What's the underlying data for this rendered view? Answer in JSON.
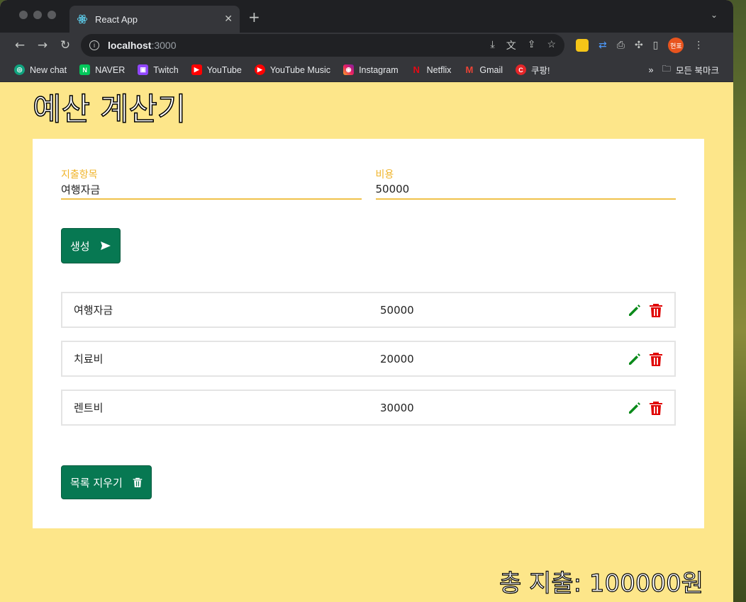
{
  "browser": {
    "tab_title": "React App",
    "url_host": "localhost",
    "url_port": ":3000",
    "avatar_text": "현표",
    "bookmarks": [
      "New chat",
      "NAVER",
      "Twitch",
      "YouTube",
      "YouTube Music",
      "Instagram",
      "Netflix",
      "Gmail",
      "쿠팡!"
    ],
    "bookmarks_overflow": "»",
    "all_bookmarks": "모든 북마크"
  },
  "app": {
    "title": "예산 계산기",
    "form": {
      "item_label": "지출항목",
      "item_value": "여행자금",
      "cost_label": "비용",
      "cost_value": "50000",
      "submit_label": "생성"
    },
    "expenses": [
      {
        "name": "여행자금",
        "cost": "50000"
      },
      {
        "name": "치료비",
        "cost": "20000"
      },
      {
        "name": "렌트비",
        "cost": "30000"
      }
    ],
    "clear_label": "목록 지우기",
    "total_text": "총 지출: 100000원"
  },
  "colors": {
    "page_bg": "#fde68a",
    "primary_button": "#077852",
    "edit_icon": "#0a8a1a",
    "delete_icon": "#e00000",
    "field_label": "#f0b42a"
  }
}
